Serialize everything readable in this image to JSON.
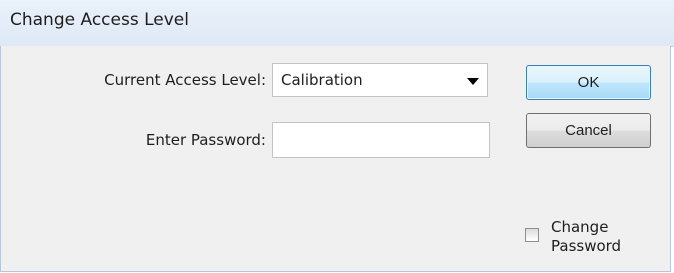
{
  "window": {
    "title": "Change Access Level"
  },
  "form": {
    "access_level_label": "Current Access Level:",
    "access_level_value": "Calibration",
    "password_label": "Enter Password:",
    "password_value": ""
  },
  "buttons": {
    "ok_label": "OK",
    "cancel_label": "Cancel"
  },
  "options": {
    "change_password_label_line1": "Change",
    "change_password_label_line2": "Password",
    "change_password_checked": false
  },
  "colors": {
    "titlebar": "#e9f1fa",
    "client_background": "#f0f0f0",
    "default_button_border": "#3c7fb1"
  }
}
